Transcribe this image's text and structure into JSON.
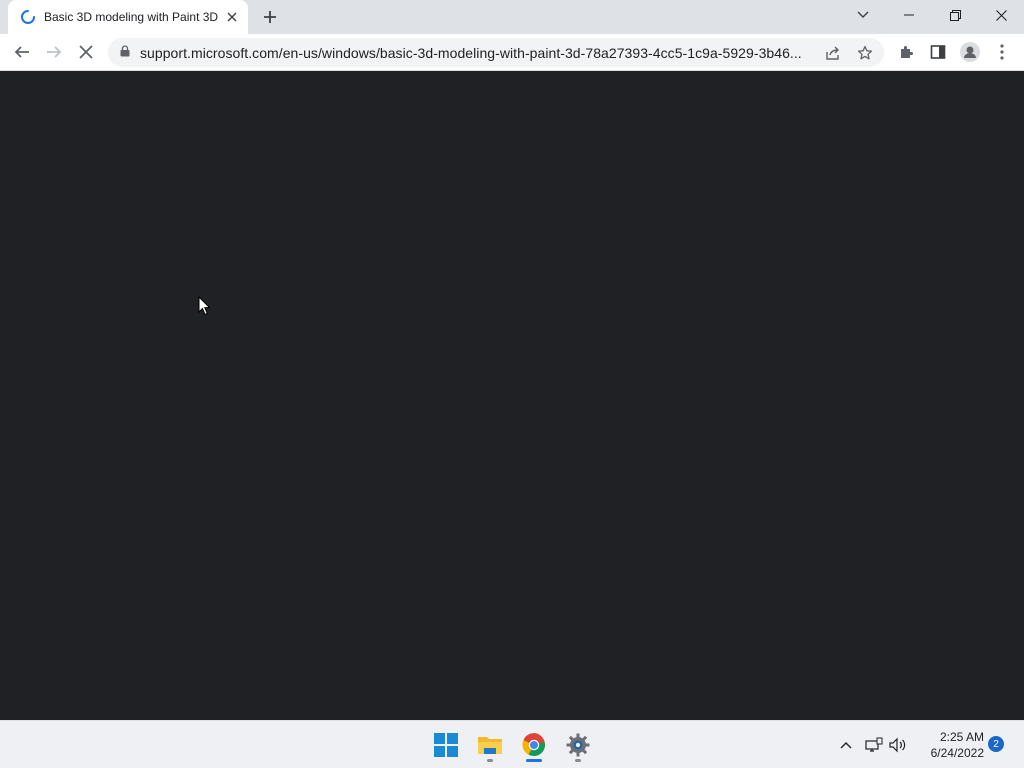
{
  "browser": {
    "tab": {
      "title": "Basic 3D modeling with Paint 3D",
      "loading": true
    },
    "address_bar": {
      "url": "support.microsoft.com/en-us/windows/basic-3d-modeling-with-paint-3d-78a27393-4cc5-1c9a-5929-3b46..."
    },
    "toolbar_icons": [
      "back-icon",
      "forward-icon",
      "stop-icon",
      "lock-icon",
      "share-icon",
      "bookmark-star-icon",
      "extensions-icon",
      "side-panel-icon",
      "profile-icon",
      "menu-icon"
    ],
    "window_controls": [
      "tab-search-icon",
      "minimize-icon",
      "restore-icon",
      "close-icon"
    ]
  },
  "page": {
    "background": "#202124"
  },
  "taskbar": {
    "apps": [
      "start-icon",
      "file-explorer-icon",
      "chrome-icon",
      "settings-icon"
    ],
    "clock": {
      "time": "2:25 AM",
      "date": "6/24/2022"
    },
    "notification_count": "2"
  },
  "colors": {
    "accent": "#1a73e8",
    "tabstrip": "#dee1e6",
    "content_bg": "#202124"
  }
}
